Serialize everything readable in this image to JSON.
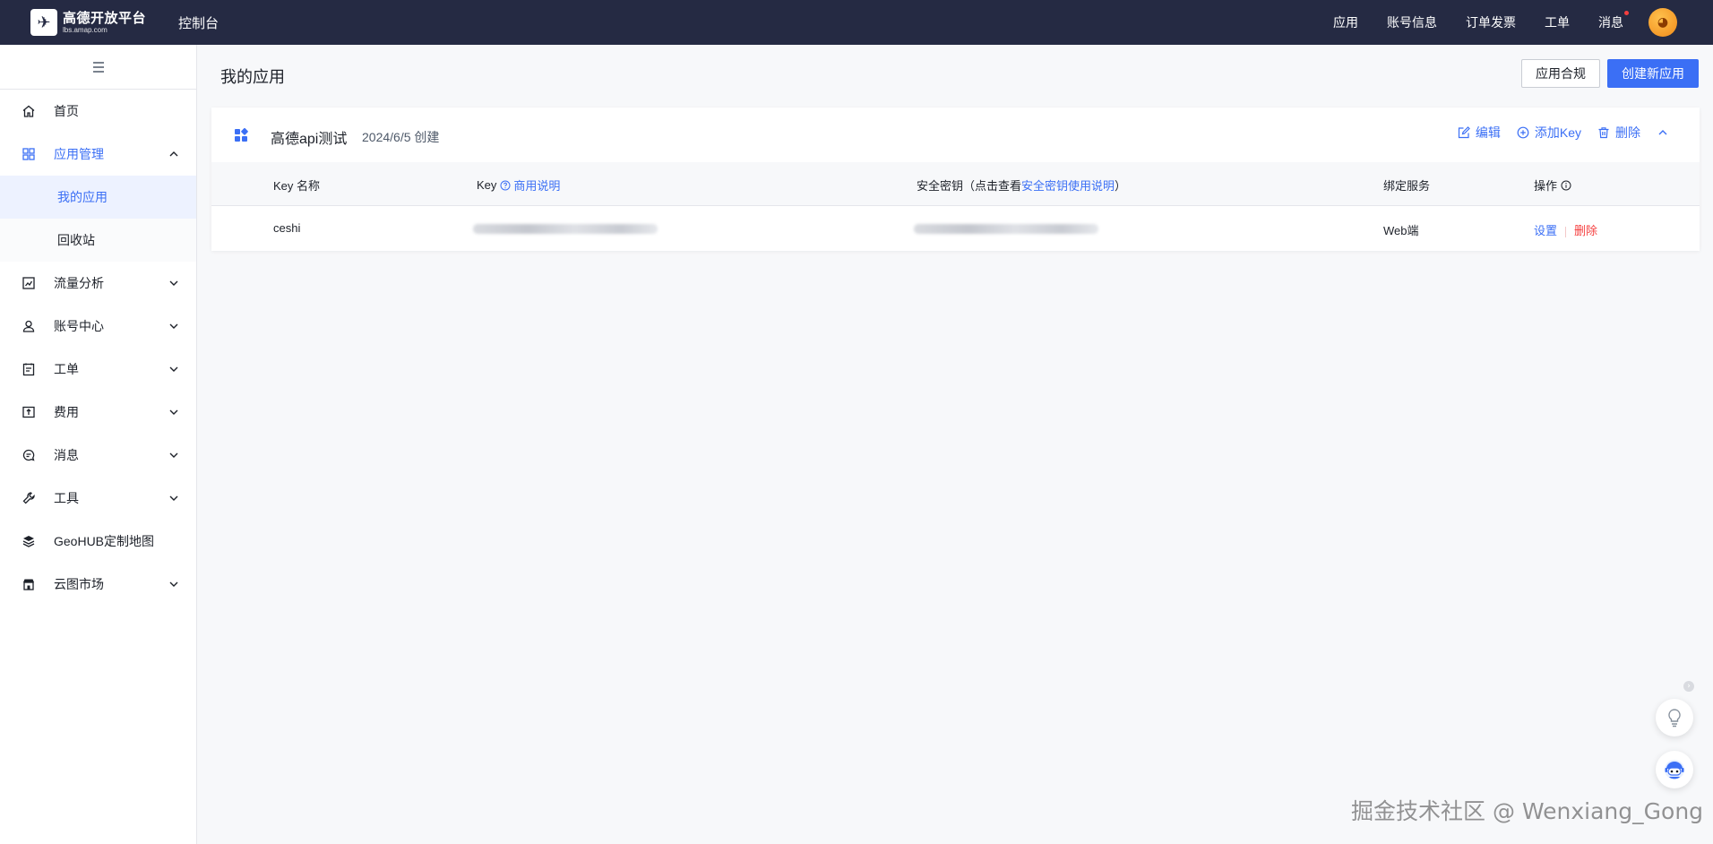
{
  "topbar": {
    "logo_title": "高德开放平台",
    "logo_sub": "lbs.amap.com",
    "console": "控制台",
    "nav": [
      "应用",
      "账号信息",
      "订单发票",
      "工单",
      "消息"
    ]
  },
  "sidebar": {
    "items": [
      {
        "label": "首页",
        "icon": "home-icon"
      },
      {
        "label": "应用管理",
        "icon": "grid-icon"
      },
      {
        "label": "我的应用"
      },
      {
        "label": "回收站"
      },
      {
        "label": "流量分析",
        "icon": "chart-icon"
      },
      {
        "label": "账号中心",
        "icon": "user-icon"
      },
      {
        "label": "工单",
        "icon": "clipboard-icon"
      },
      {
        "label": "费用",
        "icon": "wallet-icon"
      },
      {
        "label": "消息",
        "icon": "message-icon"
      },
      {
        "label": "工具",
        "icon": "wrench-icon"
      },
      {
        "label": "GeoHUB定制地图",
        "icon": "layers-icon"
      },
      {
        "label": "云图市场",
        "icon": "store-icon"
      }
    ]
  },
  "main": {
    "title": "我的应用",
    "compliance_button": "应用合规",
    "create_button": "创建新应用"
  },
  "app": {
    "name": "高德api测试",
    "created": "2024/6/5 创建",
    "actions": {
      "edit": "编辑",
      "add_key": "添加Key",
      "delete": "删除"
    },
    "columns": {
      "key_name": "Key 名称",
      "key": "Key",
      "commercial": "商用说明",
      "secret_prefix": "安全密钥（点击查看",
      "secret_link": "安全密钥使用说明",
      "secret_suffix": "）",
      "service": "绑定服务",
      "ops": "操作"
    },
    "rows": [
      {
        "key_name": "ceshi",
        "service": "Web端",
        "op_settings": "设置",
        "op_delete": "删除"
      }
    ]
  },
  "watermark": "掘金技术社区 @ Wenxiang_Gong",
  "colors": {
    "accent": "#3b6ff5",
    "topbar": "#252a43",
    "danger": "#f53f3f"
  }
}
